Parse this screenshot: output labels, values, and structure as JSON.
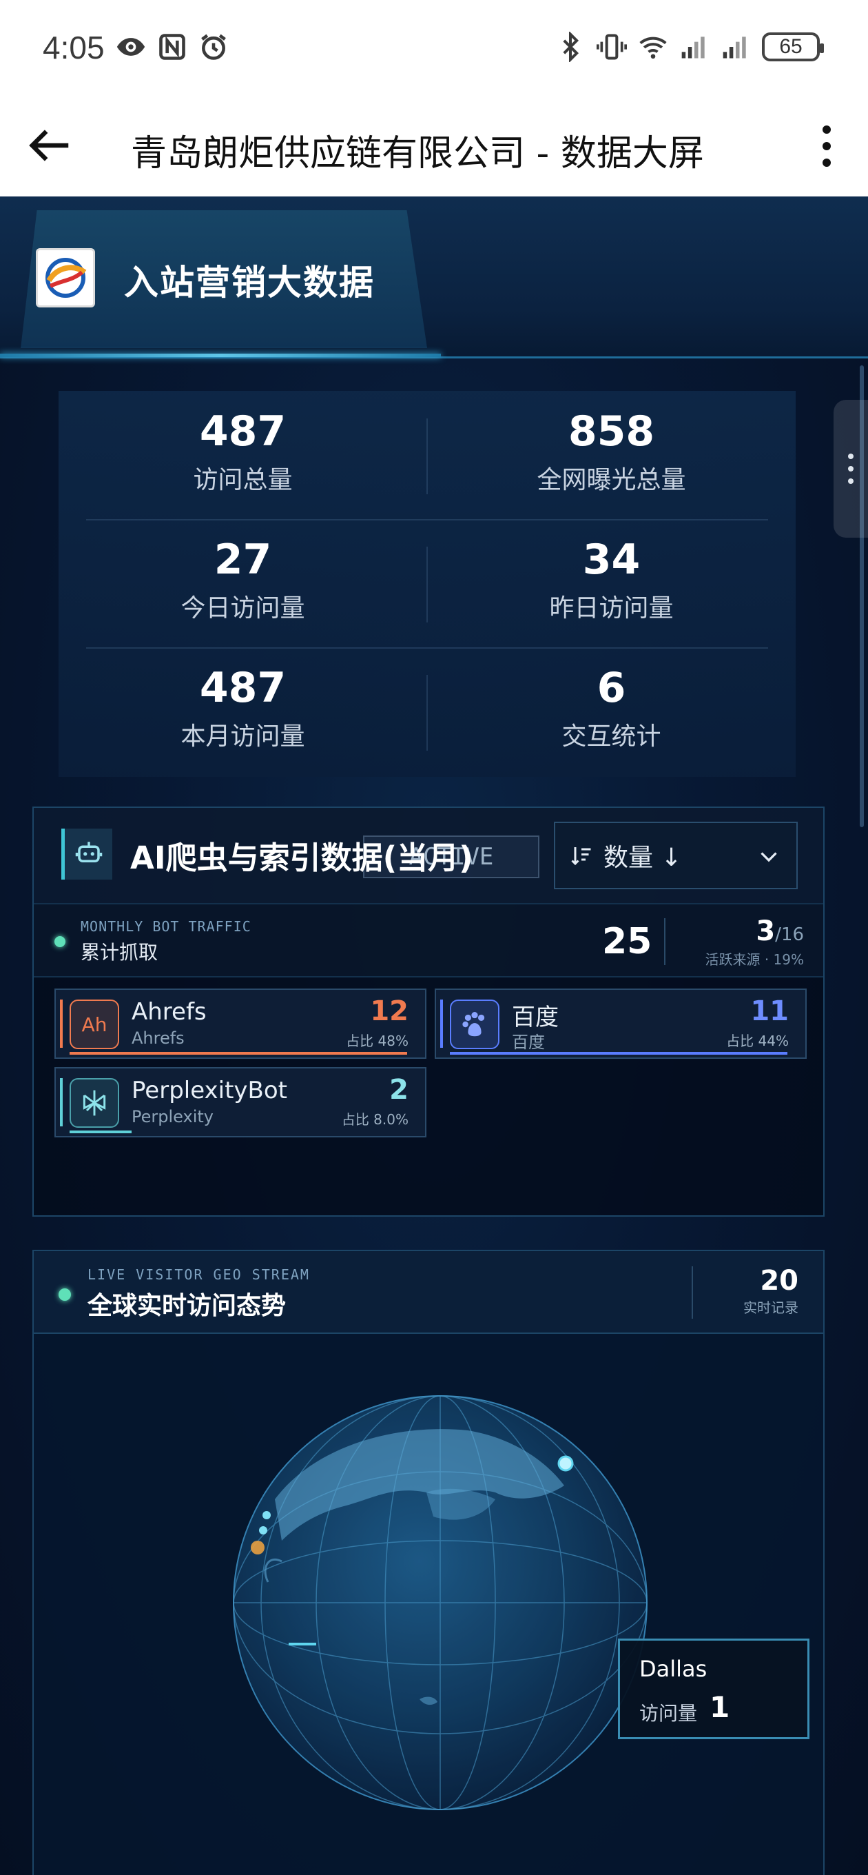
{
  "status_bar": {
    "time": "4:05",
    "battery": "65"
  },
  "app_bar": {
    "title": "青岛朗炬供应链有限公司 - 数据大屏"
  },
  "header": {
    "title": "入站营销大数据"
  },
  "stats": [
    {
      "value": "487",
      "label": "访问总量"
    },
    {
      "value": "858",
      "label": "全网曝光总量"
    },
    {
      "value": "27",
      "label": "今日访问量"
    },
    {
      "value": "34",
      "label": "昨日访问量"
    },
    {
      "value": "487",
      "label": "本月访问量"
    },
    {
      "value": "6",
      "label": "交互统计"
    }
  ],
  "bot_panel": {
    "title": "AI爬虫与索引数据(当月)",
    "active_pill": "ACTIVE",
    "sort_label": "数量 ↓",
    "traffic": {
      "en_label": "MONTHLY BOT TRAFFIC",
      "cn_label": "累计抓取",
      "total": "25",
      "active": "3",
      "active_total": "/16",
      "active_sub": "活跃来源 · 19%"
    },
    "bots": [
      {
        "name": "Ahrefs",
        "sub": "Ahrefs",
        "count": "12",
        "pct": "占比 48%",
        "color": "#f07a4f",
        "icon_text": "Ah",
        "share": 0.48
      },
      {
        "name": "百度",
        "sub": "百度",
        "count": "11",
        "pct": "占比 44%",
        "color": "#5a7dff",
        "icon_text": "du",
        "share": 0.44
      },
      {
        "name": "PerplexityBot",
        "sub": "Perplexity",
        "count": "2",
        "pct": "占比 8.0%",
        "color": "#5fd0d8",
        "icon_text": "",
        "share": 0.08
      }
    ]
  },
  "geo_panel": {
    "en_label": "LIVE VISITOR GEO STREAM",
    "cn_label": "全球实时访问态势",
    "count": "20",
    "count_label": "实时记录",
    "tooltip": {
      "city": "Dallas",
      "label": "访问量",
      "value": "1"
    }
  }
}
